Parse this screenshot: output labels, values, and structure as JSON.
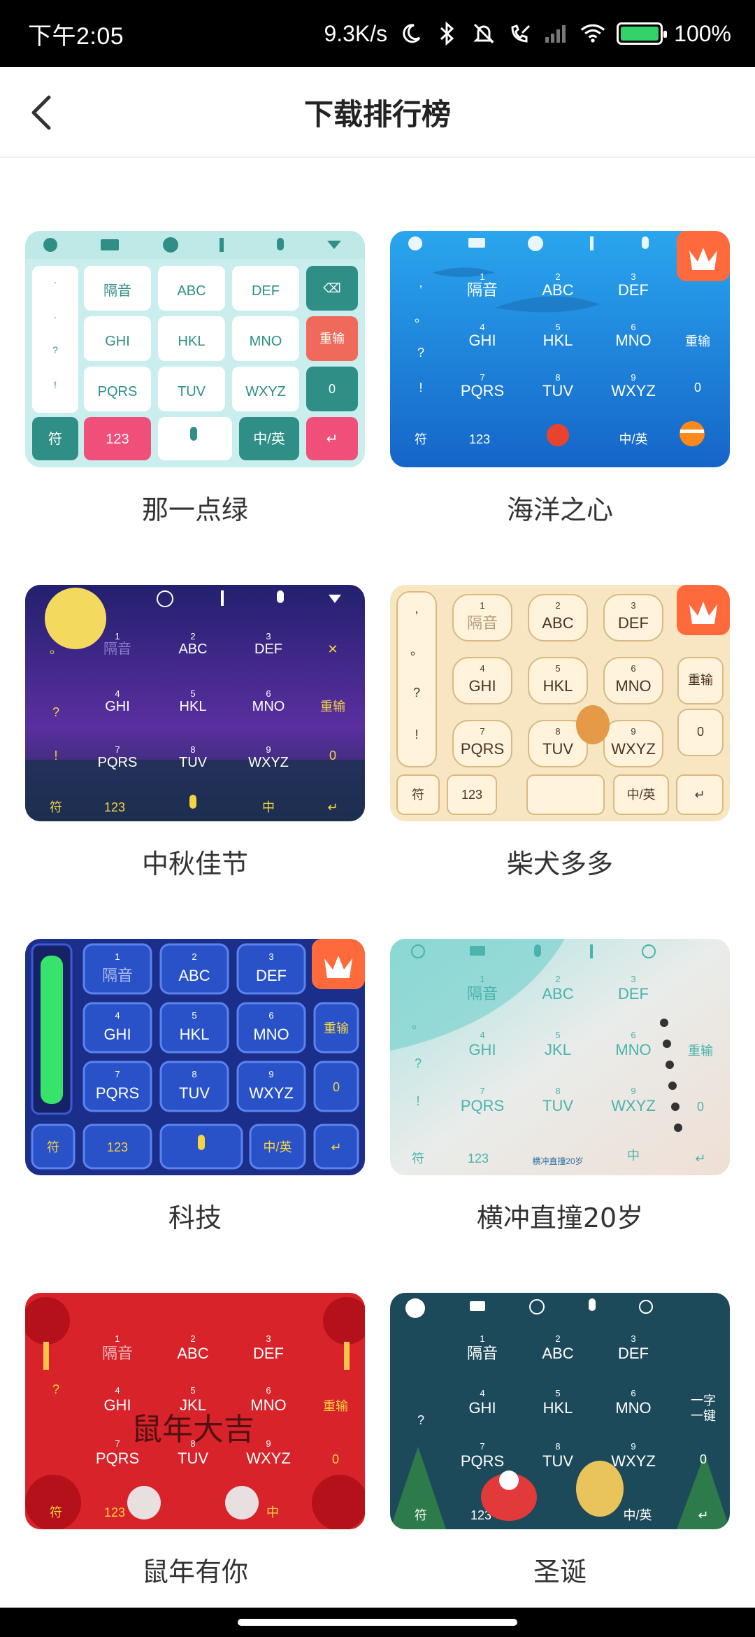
{
  "status_bar": {
    "time": "下午2:05",
    "network_speed": "9.3K/s",
    "battery_percent": "100%",
    "icons": [
      "moon-icon",
      "bluetooth-icon",
      "bell-muted-icon",
      "call-forward-icon",
      "signal-icon",
      "wifi-icon",
      "battery-icon"
    ]
  },
  "header": {
    "back_icon": "chevron-left-icon",
    "title": "下载排行榜"
  },
  "skins": [
    {
      "name": "那一点绿",
      "has_crown": false
    },
    {
      "name": "海洋之心",
      "has_crown": true
    },
    {
      "name": "中秋佳节",
      "has_crown": false
    },
    {
      "name": "柴犬多多",
      "has_crown": true
    },
    {
      "name": "科技",
      "has_crown": true
    },
    {
      "name": "横冲直撞20岁",
      "has_crown": false
    },
    {
      "name": "鼠年有你",
      "has_crown": false
    },
    {
      "name": "圣诞",
      "has_crown": false
    }
  ],
  "keyboard": {
    "keys_row1": [
      {
        "num": "1",
        "label": "隔音"
      },
      {
        "num": "2",
        "label": "ABC"
      },
      {
        "num": "3",
        "label": "DEF"
      }
    ],
    "keys_row2": [
      {
        "num": "4",
        "label": "GHI"
      },
      {
        "num": "5",
        "label": "HKL"
      },
      {
        "num": "6",
        "label": "MNO"
      }
    ],
    "keys_row3": [
      {
        "num": "7",
        "label": "PQRS"
      },
      {
        "num": "8",
        "label": "TUV"
      },
      {
        "num": "9",
        "label": "WXYZ"
      }
    ],
    "side_right": [
      "重输",
      "0"
    ],
    "bottom": [
      "符",
      "123",
      "中/英"
    ],
    "youth_row2_middle": "JKL",
    "youth_banner": "横冲直撞20岁",
    "rat_banner": "鼠年大吉",
    "xmas_side": "一字一键"
  },
  "colors": {
    "status_bg": "#000000",
    "accent_orange": "#ff6a3d",
    "green_theme": "#2f8f86",
    "pink_theme": "#ef4f78",
    "ocean_blue": "#1a8ee0",
    "night_purple": "#3a2a8a",
    "shiba_cream": "#f8e6c2",
    "tech_navy": "#1b2f8a",
    "sea_mint": "#bfe8e4",
    "festive_red": "#d8232a",
    "xmas_teal": "#1d4a5a"
  }
}
